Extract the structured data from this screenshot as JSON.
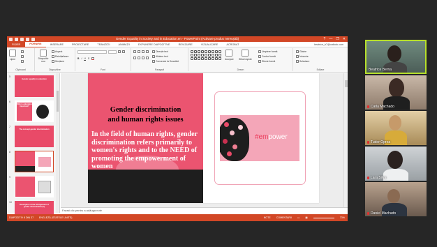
{
  "window": {
    "title": "Gender Equality in Society and in Education.en - PowerPoint (Activare produs nereușită)",
    "help": "?",
    "controls": [
      "—",
      "❐",
      "✕"
    ]
  },
  "ribbon_tabs": {
    "file": "FIȘIER",
    "items": [
      "PORNIRE",
      "INSERARE",
      "PROIECTARE",
      "TRANZIȚII",
      "ANIMAȚII",
      "EXPUNERE DIAPOZITIVE",
      "REVIZUIRE",
      "VIZUALIZARE",
      "ACROBAT"
    ],
    "active_index": 0,
    "user": "beatrice_b7@outlook.com"
  },
  "ribbon": {
    "clipboard": {
      "paste": "Lipire",
      "cut": "",
      "copy": "",
      "format": "",
      "label": "Clipboard"
    },
    "slides": {
      "new_slide": "Diapozitiv nou",
      "layout": "Aspect",
      "reset": "Reinițializare",
      "section": "Secțiune",
      "label": "Diapozitive"
    },
    "font": {
      "label": "Font"
    },
    "paragraph": {
      "text_direction": "Direcție text",
      "align_text": "Aliniere text",
      "smartart": "Conversie la SmartArt",
      "label": "Paragraf"
    },
    "drawing": {
      "arrange": "Aranjare",
      "quick_styles": "Stiluri rapide",
      "shape_fill": "Umplere formă",
      "shape_outline": "Contur formă",
      "shape_effects": "Efecte formă",
      "label": "Desen"
    },
    "editing": {
      "find": "Găsire",
      "replace": "Înlocuire",
      "select": "Selectare",
      "label": "Editare"
    }
  },
  "thumbnails": [
    {
      "num": "5",
      "text": "Gender equality in education"
    },
    {
      "num": "6",
      "text": "Why is education important?"
    },
    {
      "num": "7",
      "text": "The concept gender discrimination"
    },
    {
      "num": "8",
      "text": ""
    },
    {
      "num": "9",
      "text": ""
    },
    {
      "num": "10",
      "text": "Description of the infringement of gender discrimination(s)"
    }
  ],
  "slide": {
    "title_line1": "Gender discrimination",
    "title_line2": "and human rights issues",
    "body": "In the field of human rights, gender discrimination refers primarily to women's rights and to the NEED of promoting the empowerment of women",
    "image_brand_prefix": "#em",
    "image_brand_suffix": "power"
  },
  "notes_placeholder": "Faceți clic pentru a adăuga note",
  "status": {
    "slide_info": "DIAPOZITIV 8 DIN 37",
    "language": "ENGLEZĂ (STATELE UNITE)",
    "notes": "NOTE",
    "comments": "COMENTARII",
    "zoom": "73%"
  },
  "participants": [
    {
      "name": "Beatrice Berna",
      "active": true,
      "muted": false
    },
    {
      "name": "Carla Machado",
      "active": false,
      "muted": true
    },
    {
      "name": "Tudor Oprea",
      "active": false,
      "muted": true
    },
    {
      "name": "Lara Silva",
      "active": false,
      "muted": true
    },
    {
      "name": "Daniel Machado",
      "active": false,
      "muted": true
    }
  ],
  "colors": {
    "ppt_accent": "#d24726",
    "slide_pink": "#eb5470",
    "active_speaker": "#b7e02a"
  }
}
